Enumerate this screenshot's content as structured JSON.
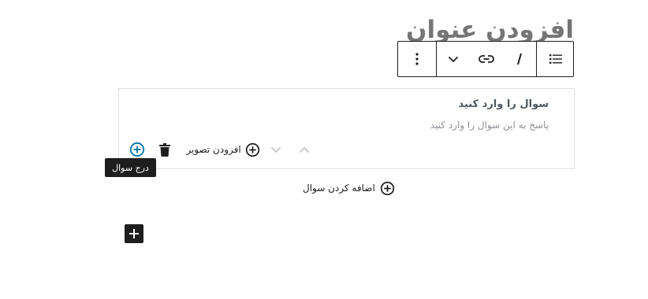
{
  "heading": {
    "text": "افزودن عنوان"
  },
  "toolbar": {
    "items": [
      {
        "icon": "more-options-icon"
      },
      {
        "icon": "chevron-down-icon"
      },
      {
        "icon": "link-icon"
      },
      {
        "icon": "italic-icon"
      },
      {
        "icon": "list-icon"
      }
    ]
  },
  "faq": {
    "question_placeholder": "سوال را وارد کنید",
    "answer_placeholder": "پاسخ به این سوال را وارد کنید",
    "add_image_label": "افزودن تصویر"
  },
  "tooltip": {
    "text": "درج سوال"
  },
  "add_question": {
    "label": "اضافه کردن سوال"
  },
  "colors": {
    "accent": "#0073aa",
    "dark": "#1e1e1e",
    "muted": "#757575"
  }
}
